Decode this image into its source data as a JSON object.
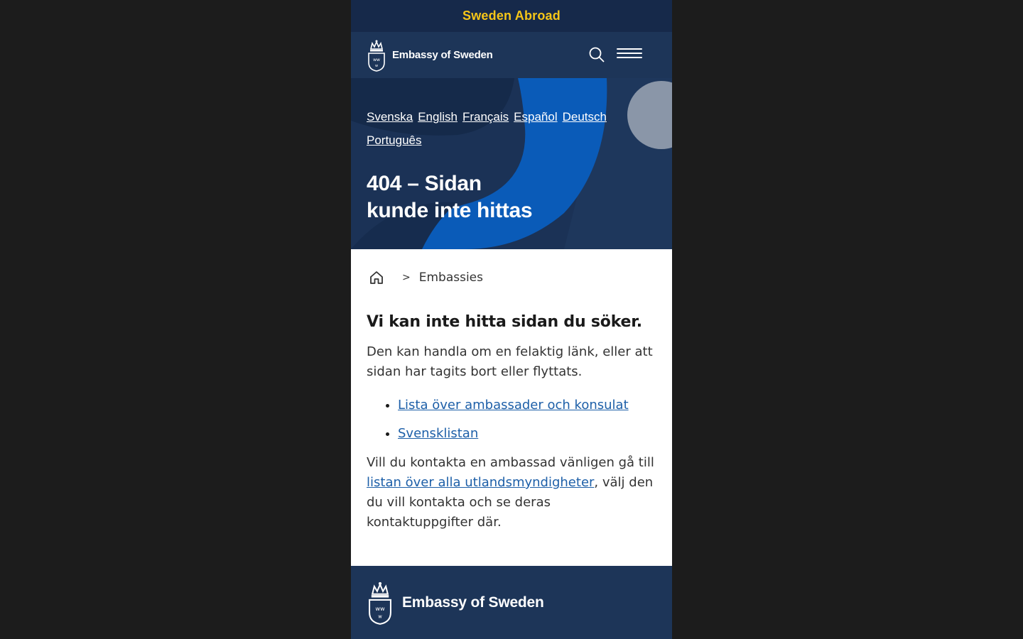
{
  "site": {
    "top_label": "Sweden Abroad",
    "brand": "Embassy of Sweden"
  },
  "languages": [
    "Svenska",
    "English",
    "Français",
    "Español",
    "Deutsch",
    "Português"
  ],
  "hero": {
    "line1": "404 – Sidan",
    "line2": "kunde inte hittas"
  },
  "breadcrumb": {
    "separator": ">",
    "current": "Embassies"
  },
  "main": {
    "heading": "Vi kan inte hitta sidan du söker.",
    "intro": "Den kan handla om en felaktig länk, eller att sidan har tagits bort eller flyttats.",
    "links": [
      "Lista över ambassader och konsulat",
      "Svensklistan"
    ],
    "contact_before": "Vill du kontakta en ambassad vänligen gå till ",
    "contact_link": "listan över alla utlandsmyndigheter",
    "contact_after": ", välj den du vill kontakta och se deras kontaktuppgifter där."
  },
  "footer": {
    "brand": "Embassy of Sweden"
  },
  "colors": {
    "navy": "#1d3558",
    "accent": "#f5c518",
    "link": "#1d5fa8",
    "hero_blue": "#0a5bb8"
  }
}
